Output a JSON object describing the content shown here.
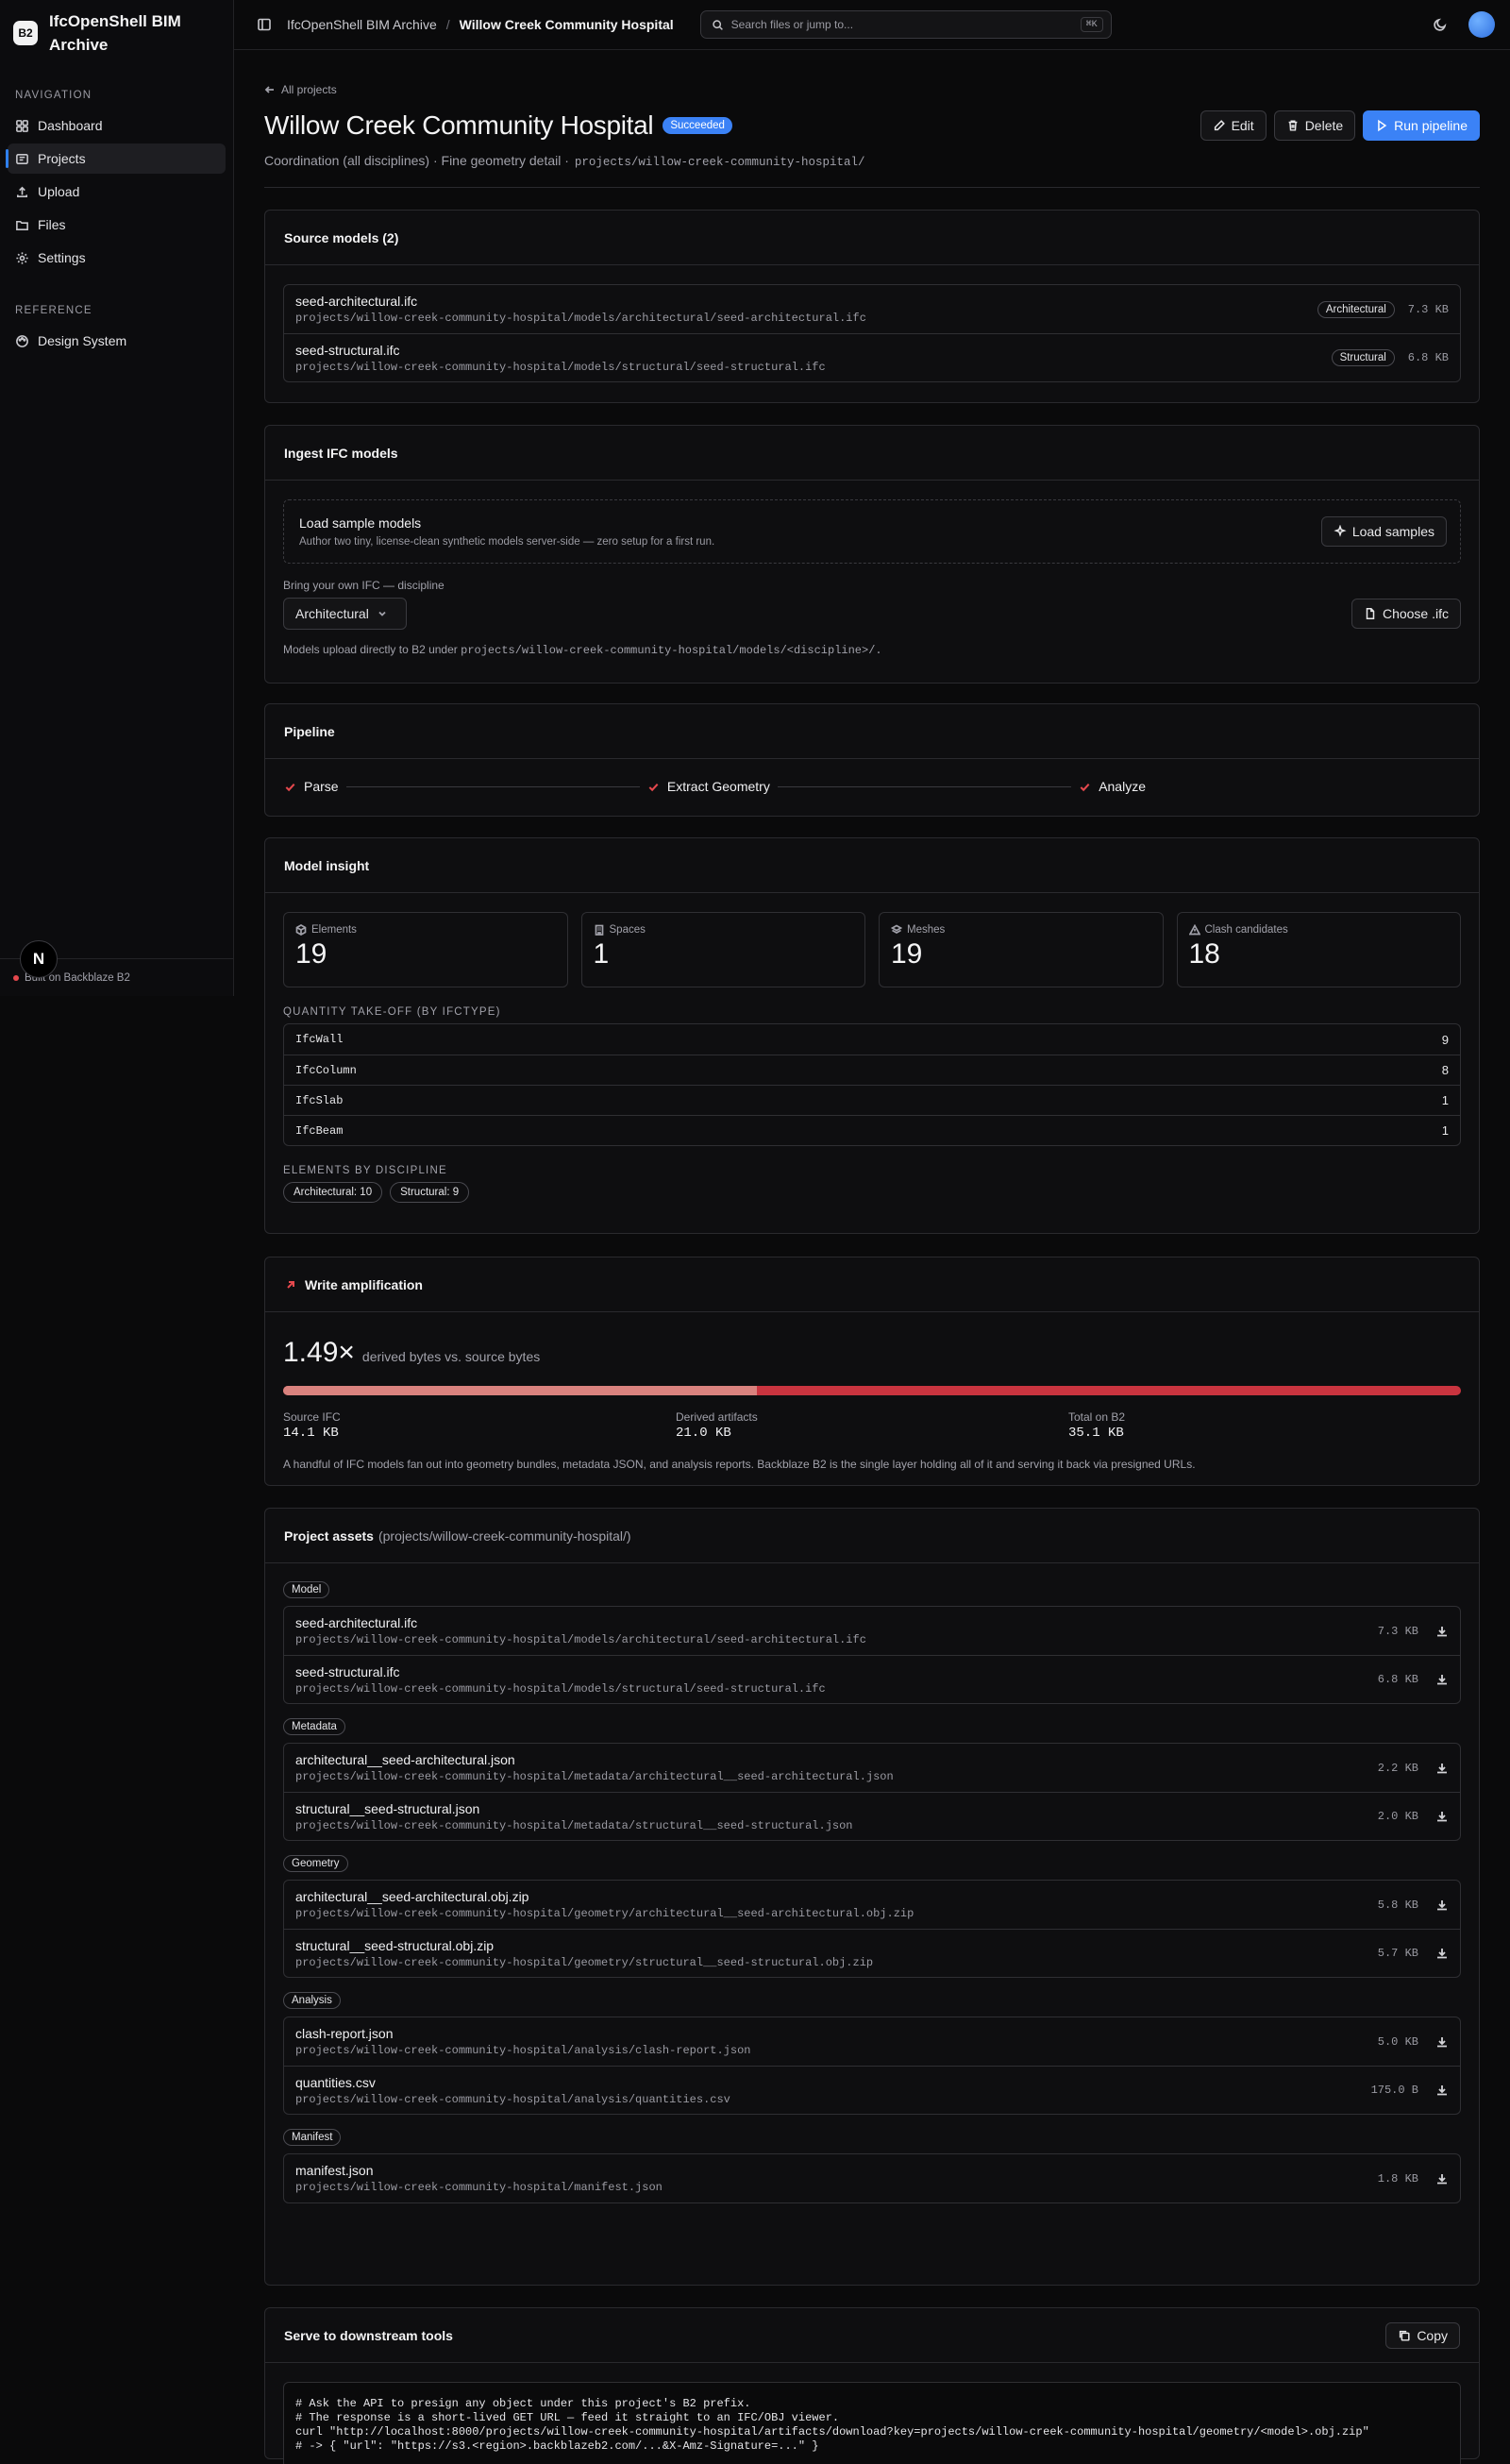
{
  "app": {
    "logo": "B2",
    "name": "IfcOpenShell BIM Archive"
  },
  "sidebar": {
    "nav_title": "NAVIGATION",
    "items": [
      {
        "label": "Dashboard",
        "icon": "dashboard-icon"
      },
      {
        "label": "Projects",
        "icon": "projects-icon",
        "active": true
      },
      {
        "label": "Upload",
        "icon": "upload-icon"
      },
      {
        "label": "Files",
        "icon": "folder-icon"
      },
      {
        "label": "Settings",
        "icon": "gear-icon"
      }
    ],
    "ref_title": "REFERENCE",
    "ref_items": [
      {
        "label": "Design System",
        "icon": "palette-icon"
      }
    ],
    "footer": "Built on Backblaze B2",
    "bubble": "N"
  },
  "topbar": {
    "crumb_root": "IfcOpenShell BIM Archive",
    "crumb_sep": "/",
    "crumb_current": "Willow Creek Community Hospital",
    "search_placeholder": "Search files or jump to...",
    "search_kbd": "⌘K"
  },
  "project": {
    "back": "All projects",
    "title": "Willow Creek Community Hospital",
    "status": "Succeeded",
    "subtitle": "Coordination (all disciplines) · Fine geometry detail ·",
    "prefix": "projects/willow-creek-community-hospital/",
    "actions": {
      "edit": "Edit",
      "delete": "Delete",
      "run": "Run pipeline"
    }
  },
  "source_models": {
    "title": "Source models (2)",
    "files": [
      {
        "name": "seed-architectural.ifc",
        "path": "projects/willow-creek-community-hospital/models/architectural/seed-architectural.ifc",
        "tag": "Architectural",
        "size": "7.3 KB"
      },
      {
        "name": "seed-structural.ifc",
        "path": "projects/willow-creek-community-hospital/models/structural/seed-structural.ifc",
        "tag": "Structural",
        "size": "6.8 KB"
      }
    ]
  },
  "ingest": {
    "title": "Ingest IFC models",
    "sample_title": "Load sample models",
    "sample_desc": "Author two tiny, license-clean synthetic models server-side — zero setup for a first run.",
    "sample_button": "Load samples",
    "byo_label": "Bring your own IFC — discipline",
    "discipline": "Architectural",
    "choose_button": "Choose .ifc",
    "helper_prefix": "Models upload directly to B2 under",
    "helper_path": "projects/willow-creek-community-hospital/models/<discipline>/."
  },
  "pipeline": {
    "title": "Pipeline",
    "steps": [
      {
        "label": "Parse"
      },
      {
        "label": "Extract Geometry"
      },
      {
        "label": "Analyze"
      }
    ]
  },
  "insight": {
    "title": "Model insight",
    "stats": [
      {
        "label": "Elements",
        "value": "19",
        "icon": "cube-icon"
      },
      {
        "label": "Spaces",
        "value": "1",
        "icon": "building-icon"
      },
      {
        "label": "Meshes",
        "value": "19",
        "icon": "layers-icon"
      },
      {
        "label": "Clash candidates",
        "value": "18",
        "icon": "warning-icon"
      }
    ],
    "qto_title": "QUANTITY TAKE-OFF (BY IFCTYPE)",
    "qto": [
      {
        "type": "IfcWall",
        "count": "9"
      },
      {
        "type": "IfcColumn",
        "count": "8"
      },
      {
        "type": "IfcSlab",
        "count": "1"
      },
      {
        "type": "IfcBeam",
        "count": "1"
      }
    ],
    "disc_title": "ELEMENTS BY DISCIPLINE",
    "disciplines": [
      "Architectural: 10",
      "Structural: 9"
    ]
  },
  "amplification": {
    "title": "Write amplification",
    "value": "1.49×",
    "desc": "derived bytes vs. source bytes",
    "source_fraction": 0.402,
    "cols": [
      {
        "label": "Source IFC",
        "value": "14.1 KB"
      },
      {
        "label": "Derived artifacts",
        "value": "21.0 KB"
      },
      {
        "label": "Total on B2",
        "value": "35.1 KB"
      }
    ],
    "note": "A handful of IFC models fan out into geometry bundles, metadata JSON, and analysis reports. Backblaze B2 is the single layer holding all of it and serving it back via presigned URLs."
  },
  "assets": {
    "title": "Project assets",
    "prefix": "(projects/willow-creek-community-hospital/)",
    "groups": [
      {
        "label": "Model",
        "files": [
          {
            "name": "seed-architectural.ifc",
            "path": "projects/willow-creek-community-hospital/models/architectural/seed-architectural.ifc",
            "size": "7.3 KB"
          },
          {
            "name": "seed-structural.ifc",
            "path": "projects/willow-creek-community-hospital/models/structural/seed-structural.ifc",
            "size": "6.8 KB"
          }
        ]
      },
      {
        "label": "Metadata",
        "files": [
          {
            "name": "architectural__seed-architectural.json",
            "path": "projects/willow-creek-community-hospital/metadata/architectural__seed-architectural.json",
            "size": "2.2 KB"
          },
          {
            "name": "structural__seed-structural.json",
            "path": "projects/willow-creek-community-hospital/metadata/structural__seed-structural.json",
            "size": "2.0 KB"
          }
        ]
      },
      {
        "label": "Geometry",
        "files": [
          {
            "name": "architectural__seed-architectural.obj.zip",
            "path": "projects/willow-creek-community-hospital/geometry/architectural__seed-architectural.obj.zip",
            "size": "5.8 KB"
          },
          {
            "name": "structural__seed-structural.obj.zip",
            "path": "projects/willow-creek-community-hospital/geometry/structural__seed-structural.obj.zip",
            "size": "5.7 KB"
          }
        ]
      },
      {
        "label": "Analysis",
        "files": [
          {
            "name": "clash-report.json",
            "path": "projects/willow-creek-community-hospital/analysis/clash-report.json",
            "size": "5.0 KB"
          },
          {
            "name": "quantities.csv",
            "path": "projects/willow-creek-community-hospital/analysis/quantities.csv",
            "size": "175.0 B"
          }
        ]
      },
      {
        "label": "Manifest",
        "files": [
          {
            "name": "manifest.json",
            "path": "projects/willow-creek-community-hospital/manifest.json",
            "size": "1.8 KB"
          }
        ]
      }
    ]
  },
  "serve": {
    "title": "Serve to downstream tools",
    "copy": "Copy",
    "code": [
      "# Ask the API to presign any object under this project's B2 prefix.",
      "# The response is a short-lived GET URL — feed it straight to an IFC/OBJ viewer.",
      "curl \"http://localhost:8000/projects/willow-creek-community-hospital/artifacts/download?key=projects/willow-creek-community-hospital/geometry/<model>.obj.zip\"",
      "# -> { \"url\": \"https://s3.<region>.backblazeb2.com/...&X-Amz-Signature=...\" }"
    ]
  }
}
